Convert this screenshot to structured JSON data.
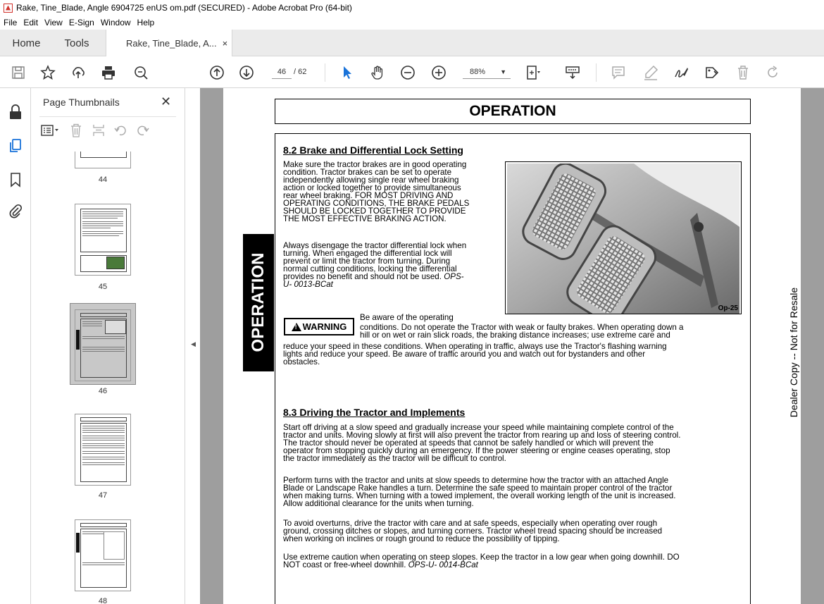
{
  "window": {
    "title": "Rake, Tine_Blade, Angle 6904725 enUS om.pdf (SECURED) - Adobe Acrobat Pro (64-bit)"
  },
  "menu": [
    "File",
    "Edit",
    "View",
    "E-Sign",
    "Window",
    "Help"
  ],
  "tabs": {
    "home": "Home",
    "tools": "Tools",
    "doc": "Rake, Tine_Blade, A...",
    "close": "×"
  },
  "toolbar": {
    "page_current": "46",
    "page_total": "/ 62",
    "zoom": "88%"
  },
  "thumbnails": {
    "title": "Page Thumbnails",
    "close": "✕",
    "pages": [
      "44",
      "45",
      "46",
      "47",
      "48"
    ]
  },
  "document": {
    "header": "OPERATION",
    "side_tab": "OPERATION",
    "watermark": "Dealer Copy -- Not for Resale",
    "photo_caption": "Op-25",
    "warning_label": "WARNING",
    "section1": {
      "title": "8.2 Brake and Differential Lock Setting",
      "p1": [
        "Make sure the tractor brakes are in good operating",
        "condition. Tractor brakes can be set to operate",
        "independently allowing single rear wheel braking",
        "action or locked together to provide simultaneous",
        "rear wheel braking.  FOR MOST DRIVING AND",
        "OPERATING CONDITIONS, THE BRAKE PEDALS",
        "SHOULD BE LOCKED TOGETHER TO PROVIDE",
        "THE MOST EFFECTIVE BRAKING ACTION."
      ],
      "p2": [
        "Always disengage the tractor differential lock when",
        "turning. When engaged the differential lock will",
        "prevent or limit the tractor from turning. During",
        "normal cutting conditions, locking the differential",
        "provides no benefit and should not be used.  "
      ],
      "p2_code": "OPS-",
      "p2_code2": "U- 0013-BCat",
      "warn_lines": [
        "Be   aware   of   the   operating",
        "conditions. Do not operate the Tractor with weak or faulty brakes.  When operating down a",
        "hill or on wet or rain slick roads, the braking distance increases; use extreme care and",
        "reduce your speed in these conditions. When operating in traffic, always use the Tractor's flashing warning",
        "lights and reduce your speed. Be aware of traffic around you and watch out for bystanders and  other",
        "obstacles."
      ]
    },
    "section2": {
      "title": "8.3 Driving the Tractor and Implements",
      "p1": [
        "Start off driving at a slow speed and gradually increase your speed while maintaining complete control of the",
        "tractor and units.  Moving slowly at first will also prevent the tractor from rearing up and loss of steering control.",
        "The tractor should never be operated at speeds that cannot be safely handled or which will prevent the",
        "operator from stopping quickly during an emergency.  If the power steering or engine ceases operating, stop",
        "the tractor immediately as the tractor will be difficult to control."
      ],
      "p2": [
        "Perform turns with the tractor and units at slow speeds to determine how the tractor with an attached Angle",
        "Blade or Landscape Rake handles a turn.  Determine the safe speed to maintain proper control of the tractor",
        "when making turns.  When turning with a towed implement, the overall working length of the unit is increased.",
        "Allow additional clearance for the units when turning."
      ],
      "p3": [
        "To avoid overturns, drive the tractor with care and at safe speeds, especially when operating over rough",
        "ground, crossing ditches or slopes, and turning corners.  Tractor wheel tread spacing should be increased",
        "when working on inclines or rough ground to reduce the possibility of tipping."
      ],
      "p4": [
        "Use extreme caution when operating on steep slopes. Keep the tractor in a low gear when going downhill.  DO",
        "NOT coast or free-wheel downhill.  "
      ],
      "p4_code": "OPS-U- 0014-BCat"
    }
  }
}
